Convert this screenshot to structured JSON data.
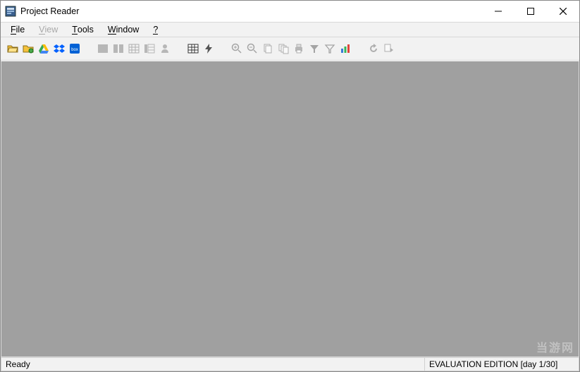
{
  "title": "Project Reader",
  "menus": [
    {
      "label": "File",
      "mn": "F",
      "enabled": true
    },
    {
      "label": "View",
      "mn": "V",
      "enabled": false
    },
    {
      "label": "Tools",
      "mn": "T",
      "enabled": true
    },
    {
      "label": "Window",
      "mn": "W",
      "enabled": true
    },
    {
      "label": "?",
      "mn": "?",
      "enabled": true
    }
  ],
  "status": {
    "left": "Ready",
    "right": "EVALUATION EDITION  [day 1/30]"
  },
  "watermark": "当游网"
}
